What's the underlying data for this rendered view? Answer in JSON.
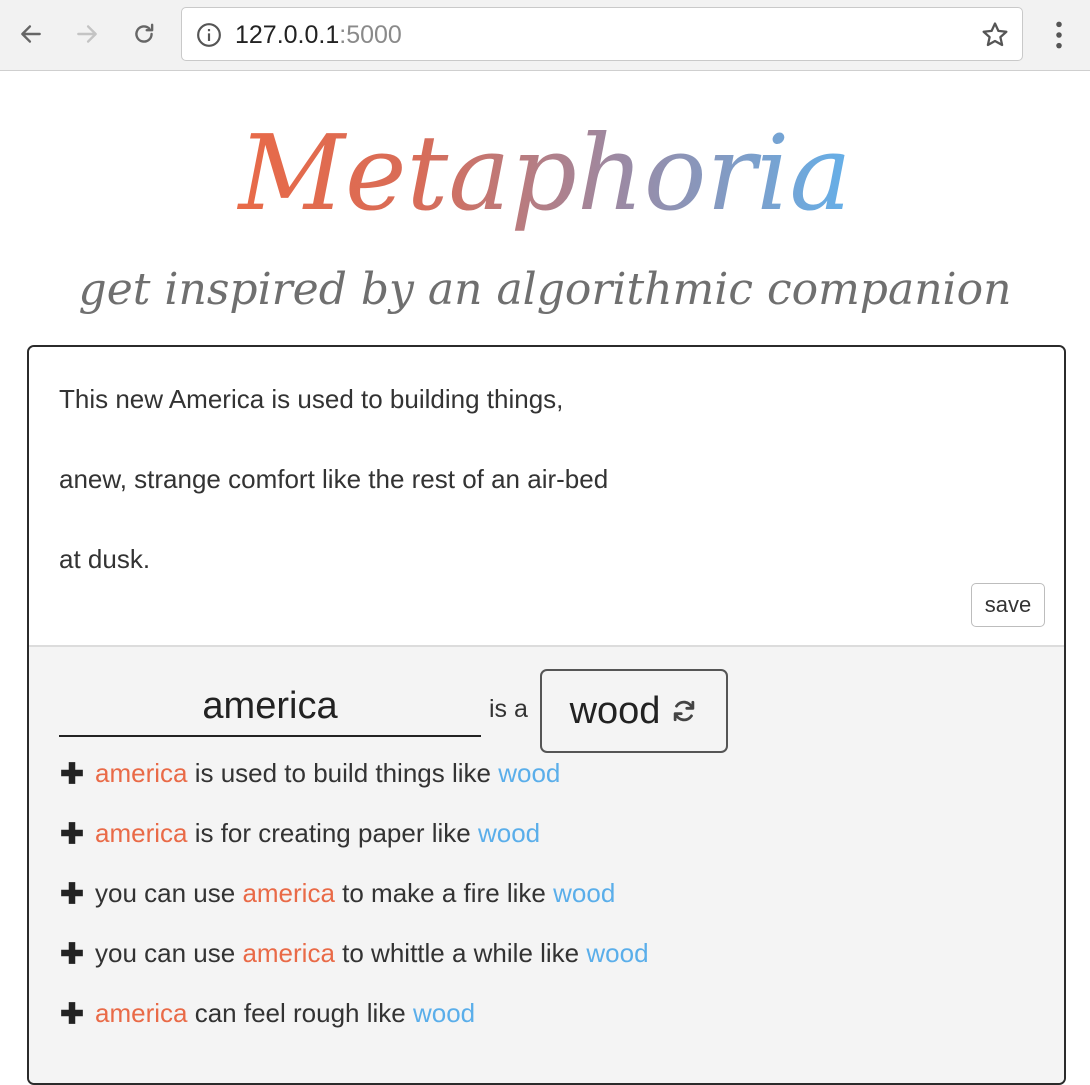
{
  "browser": {
    "url_host": "127.0.0.1",
    "url_port": ":5000"
  },
  "header": {
    "title": "Metaphoria",
    "tagline": "get inspired by an algorithmic companion"
  },
  "editor": {
    "lines": [
      "This new America is used to building things,",
      "anew, strange comfort like the rest of an air-bed",
      "at dusk."
    ],
    "save_label": "save"
  },
  "metaphor": {
    "topic_value": "america",
    "connector": "is a",
    "vehicle": "wood"
  },
  "suggestions": [
    {
      "a": "",
      "t": "america",
      "b": " is used to build things like ",
      "v": "wood"
    },
    {
      "a": "",
      "t": "america",
      "b": " is for creating paper like ",
      "v": "wood"
    },
    {
      "a": "you can use ",
      "t": "america",
      "b": " to make a fire like ",
      "v": "wood"
    },
    {
      "a": "you can use ",
      "t": "america",
      "b": " to whittle a while like ",
      "v": "wood"
    },
    {
      "a": "",
      "t": "america",
      "b": " can feel rough like ",
      "v": "wood"
    }
  ],
  "colors": {
    "tenor": "#e96a47",
    "vehicle": "#5aaeea"
  },
  "icons": {
    "back": "arrow-left-icon",
    "forward": "arrow-right-icon",
    "reload": "reload-icon",
    "info": "info-icon",
    "bookmark": "star-icon",
    "menu": "kebab-menu-icon",
    "refresh": "refresh-icon",
    "add": "plus-icon"
  }
}
